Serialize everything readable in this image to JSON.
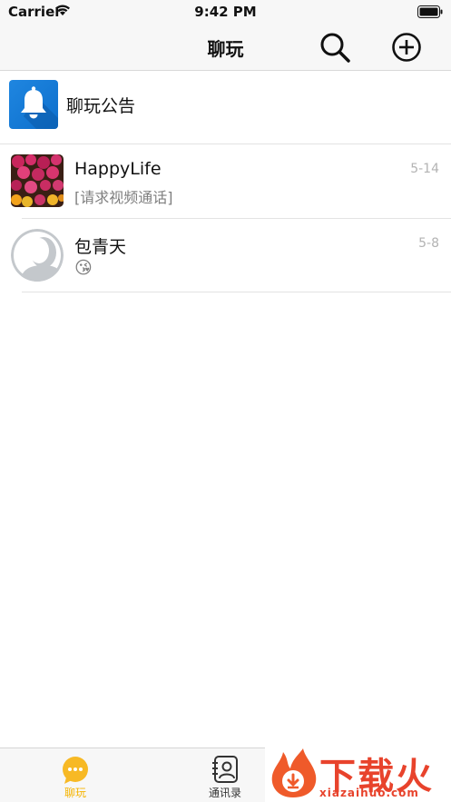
{
  "status_bar": {
    "carrier": "Carrier",
    "time": "9:42 PM",
    "wifi_icon": "wifi-icon",
    "battery_icon": "battery-icon"
  },
  "nav_bar": {
    "title": "聊玩",
    "search_icon": "search-icon",
    "add_icon": "add-circle-icon"
  },
  "announcement": {
    "label": "聊玩公告",
    "icon": "bell-icon",
    "icon_color": "#1678d6"
  },
  "chats": [
    {
      "name": "HappyLife",
      "preview": "[请求视频通话]",
      "date": "5-14",
      "avatar": "flowers-avatar"
    },
    {
      "name": "包青天",
      "preview": "😘",
      "date": "5-8",
      "avatar": "default-person-avatar"
    }
  ],
  "tab_bar": {
    "tabs": [
      {
        "label": "聊玩",
        "icon": "chat-bubble-icon",
        "active": true
      },
      {
        "label": "通讯录",
        "icon": "contacts-book-icon",
        "active": false
      }
    ],
    "active_color": "#f5b400"
  },
  "watermark": {
    "text_cn": "下载火",
    "text_en": "xiazaihuo.com",
    "color": "#e8432c"
  }
}
